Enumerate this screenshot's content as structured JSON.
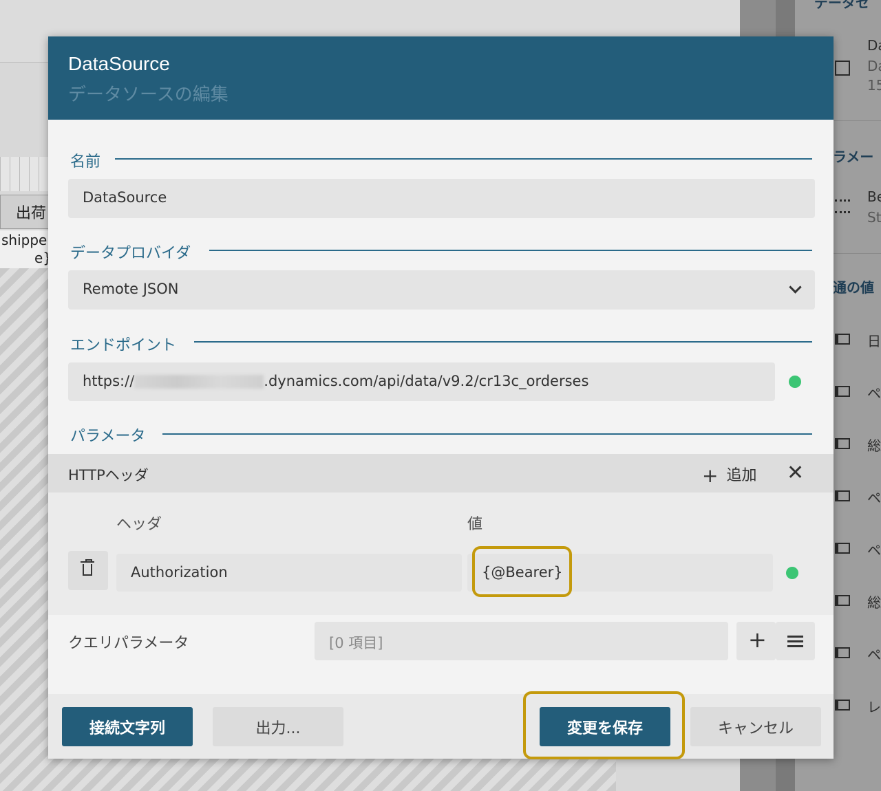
{
  "background": {
    "header_cell": "出荷",
    "field_line1": "shippe",
    "field_line2": "e}"
  },
  "right_panel": {
    "section1_title": "データセ",
    "item1_line1": "Da",
    "item1_line2": "Da",
    "item1_line3": "15",
    "section2_title": "ラメー",
    "item2_line1": "Be",
    "item2_line2": "St",
    "section3_title": "通の値",
    "items": [
      "日",
      "ペ",
      "総",
      "ペ",
      "ペ",
      "総",
      "ペ",
      "レ"
    ]
  },
  "dialog": {
    "title": "DataSource",
    "subtitle": "データソースの編集",
    "name_label": "名前",
    "name_value": "DataSource",
    "provider_label": "データプロバイダ",
    "provider_value": "Remote JSON",
    "endpoint_label": "エンドポイント",
    "endpoint_prefix": "https://",
    "endpoint_suffix": ".dynamics.com/api/data/v9.2/cr13c_orderses",
    "params_label": "パラメータ",
    "http_headers_label": "HTTPヘッダ",
    "add_label": "追加",
    "close_symbol": "✕",
    "header_col_label": "ヘッダ",
    "value_col_label": "値",
    "header_name": "Authorization",
    "header_value": "{@Bearer}",
    "query_params_label": "クエリパラメータ",
    "query_params_value": "[0 項目]",
    "plus_symbol": "+",
    "connection_string_button": "接続文字列",
    "export_button": "出力...",
    "save_button": "変更を保存",
    "cancel_button": "キャンセル"
  },
  "colors": {
    "header_bg": "#235d7a",
    "accent": "#2a6a8a",
    "status_ok": "#3cc574",
    "highlight": "#c49a0c"
  }
}
